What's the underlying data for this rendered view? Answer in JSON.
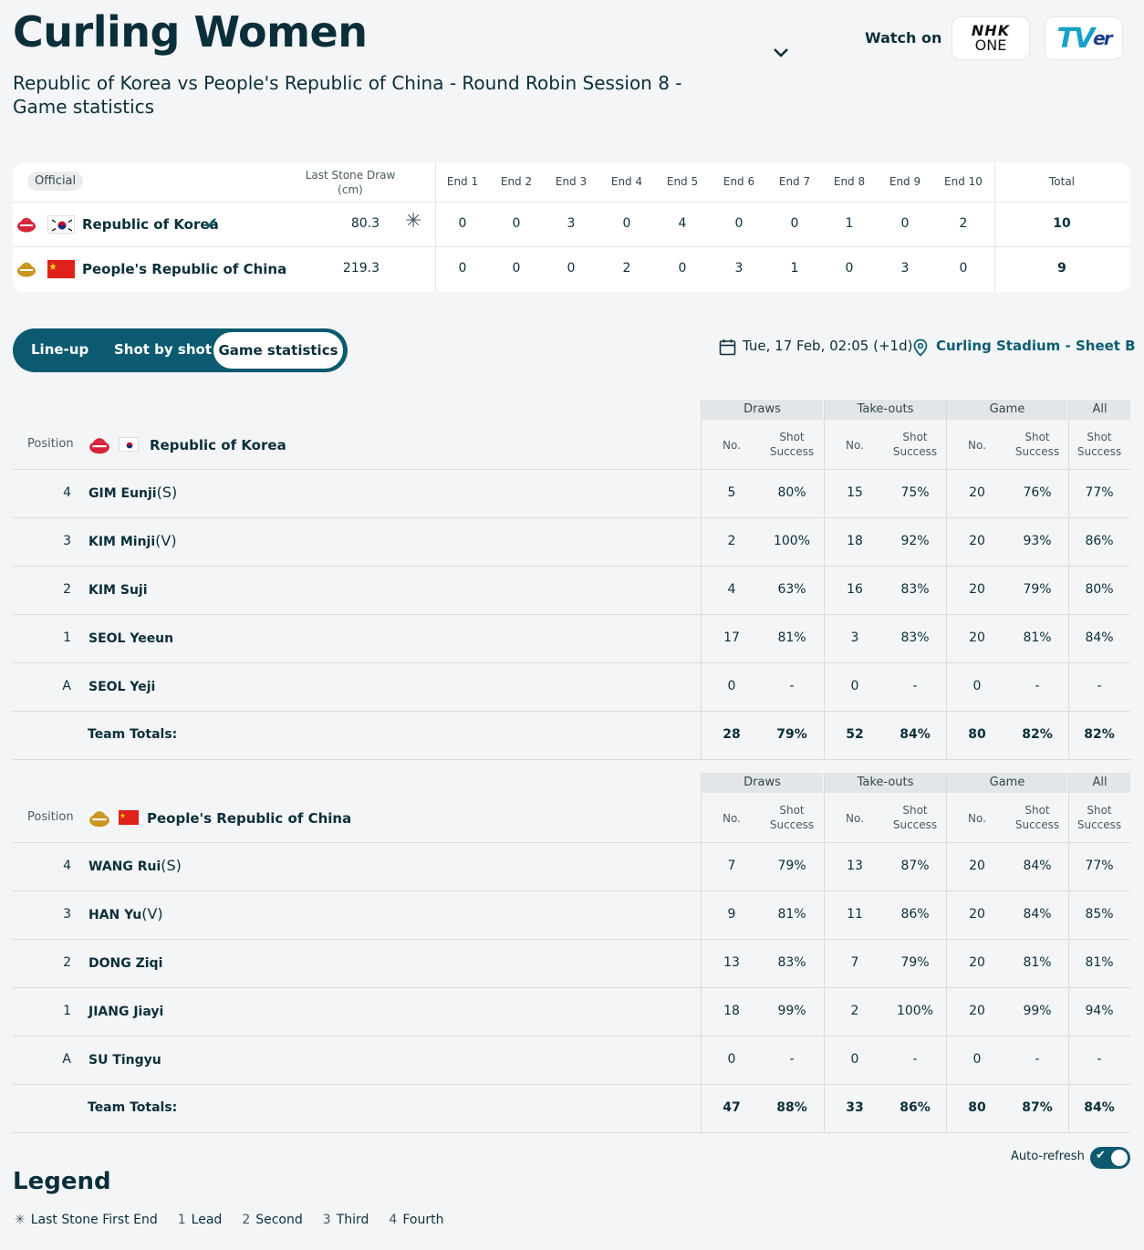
{
  "header": {
    "title": "Curling Women",
    "subtitle": "Republic of Korea vs People's Republic of China - Round Robin Session 8 - Game statistics",
    "watch_on": "Watch on",
    "broadcasters": [
      "NHK ONE",
      "TVer"
    ]
  },
  "scoreboard": {
    "official_label": "Official",
    "last_stone_label": "Last Stone Draw (cm)",
    "ends": [
      "End 1",
      "End 2",
      "End 3",
      "End 4",
      "End 5",
      "End 6",
      "End 7",
      "End 8",
      "End 9",
      "End 10"
    ],
    "total_label": "Total",
    "teams": [
      {
        "name": "Republic of Korea",
        "lsd": "80.3",
        "hammer": true,
        "winner": true,
        "scores": [
          "0",
          "0",
          "3",
          "0",
          "4",
          "0",
          "0",
          "1",
          "0",
          "2"
        ],
        "total": "10"
      },
      {
        "name": "People's Republic of China",
        "lsd": "219.3",
        "hammer": false,
        "winner": false,
        "scores": [
          "0",
          "0",
          "0",
          "2",
          "0",
          "3",
          "1",
          "0",
          "3",
          "0"
        ],
        "total": "9"
      }
    ]
  },
  "tabs": [
    "Line-up",
    "Shot by shot",
    "Game statistics"
  ],
  "active_tab": "Game statistics",
  "event_info": {
    "date": "Tue, 17 Feb, 02:05 (+1d)",
    "venue": "Curling Stadium - Sheet B"
  },
  "stats_headers": {
    "groups": [
      "Draws",
      "Take-outs",
      "Game",
      "All"
    ],
    "position": "Position",
    "no": "No.",
    "shot_success": "Shot Success",
    "team_totals": "Team Totals:"
  },
  "team_stats": [
    {
      "team": "Republic of Korea",
      "players": [
        {
          "pos": "4",
          "name": "GIM Eunji",
          "role": "(S)",
          "d_no": "5",
          "d_pct": "80%",
          "t_no": "15",
          "t_pct": "75%",
          "g_no": "20",
          "g_pct": "76%",
          "all": "77%"
        },
        {
          "pos": "3",
          "name": "KIM Minji",
          "role": "(V)",
          "d_no": "2",
          "d_pct": "100%",
          "t_no": "18",
          "t_pct": "92%",
          "g_no": "20",
          "g_pct": "93%",
          "all": "86%"
        },
        {
          "pos": "2",
          "name": "KIM Suji",
          "role": "",
          "d_no": "4",
          "d_pct": "63%",
          "t_no": "16",
          "t_pct": "83%",
          "g_no": "20",
          "g_pct": "79%",
          "all": "80%"
        },
        {
          "pos": "1",
          "name": "SEOL Yeeun",
          "role": "",
          "d_no": "17",
          "d_pct": "81%",
          "t_no": "3",
          "t_pct": "83%",
          "g_no": "20",
          "g_pct": "81%",
          "all": "84%"
        },
        {
          "pos": "A",
          "name": "SEOL Yeji",
          "role": "",
          "d_no": "0",
          "d_pct": "-",
          "t_no": "0",
          "t_pct": "-",
          "g_no": "0",
          "g_pct": "-",
          "all": "-"
        }
      ],
      "totals": {
        "d_no": "28",
        "d_pct": "79%",
        "t_no": "52",
        "t_pct": "84%",
        "g_no": "80",
        "g_pct": "82%",
        "all": "82%"
      }
    },
    {
      "team": "People's Republic of China",
      "players": [
        {
          "pos": "4",
          "name": "WANG Rui",
          "role": "(S)",
          "d_no": "7",
          "d_pct": "79%",
          "t_no": "13",
          "t_pct": "87%",
          "g_no": "20",
          "g_pct": "84%",
          "all": "77%"
        },
        {
          "pos": "3",
          "name": "HAN Yu",
          "role": "(V)",
          "d_no": "9",
          "d_pct": "81%",
          "t_no": "11",
          "t_pct": "86%",
          "g_no": "20",
          "g_pct": "84%",
          "all": "85%"
        },
        {
          "pos": "2",
          "name": "DONG Ziqi",
          "role": "",
          "d_no": "13",
          "d_pct": "83%",
          "t_no": "7",
          "t_pct": "79%",
          "g_no": "20",
          "g_pct": "81%",
          "all": "81%"
        },
        {
          "pos": "1",
          "name": "JIANG Jiayi",
          "role": "",
          "d_no": "18",
          "d_pct": "99%",
          "t_no": "2",
          "t_pct": "100%",
          "g_no": "20",
          "g_pct": "99%",
          "all": "94%"
        },
        {
          "pos": "A",
          "name": "SU Tingyu",
          "role": "",
          "d_no": "0",
          "d_pct": "-",
          "t_no": "0",
          "t_pct": "-",
          "g_no": "0",
          "g_pct": "-",
          "all": "-"
        }
      ],
      "totals": {
        "d_no": "47",
        "d_pct": "88%",
        "t_no": "33",
        "t_pct": "86%",
        "g_no": "80",
        "g_pct": "87%",
        "all": "84%"
      }
    }
  ],
  "auto_refresh": {
    "label": "Auto-refresh",
    "on": true
  },
  "legend": {
    "title": "Legend",
    "items": [
      {
        "key": "✳",
        "label": "Last Stone First End"
      },
      {
        "key": "1",
        "label": "Lead"
      },
      {
        "key": "2",
        "label": "Second"
      },
      {
        "key": "3",
        "label": "Third"
      },
      {
        "key": "4",
        "label": "Fourth"
      }
    ]
  },
  "colors": {
    "primary": "#0c5a70",
    "text": "#0b2f3a",
    "korea_stone": "#d8243a",
    "china_stone": "#c9961f",
    "china_flag": "#e0201b"
  }
}
